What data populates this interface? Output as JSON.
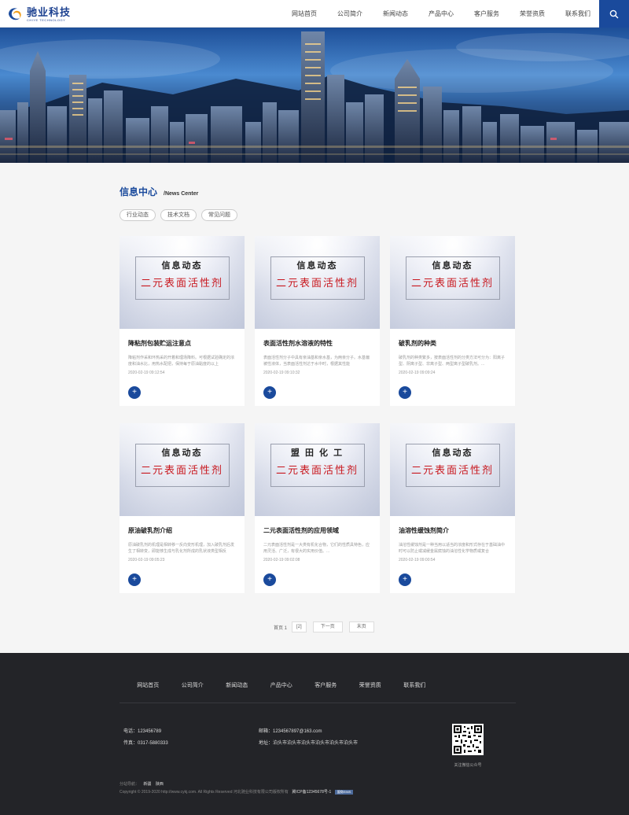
{
  "header": {
    "logo_cn": "驰业科技",
    "logo_en": "CHIYE TECHNOLOGY",
    "nav": [
      "网站首页",
      "公司简介",
      "新闻动态",
      "产品中心",
      "客户服务",
      "荣誉资质",
      "联系我们"
    ]
  },
  "section": {
    "title": "信息中心",
    "subtitle": "/News Center",
    "tabs": [
      "行业动态",
      "技术文档",
      "常见问题"
    ]
  },
  "cards": [
    {
      "img_top": "信息动态",
      "img_main": "二元表面活性剂",
      "title": "降粘剂包装贮运注意点",
      "desc": "降粘剂作采和环热采的开着和理场降料。可根据试验确定的浓度和油水比，用热水配把，保持每于原油黏度的以上",
      "date": "2020-02-19 09:12:54"
    },
    {
      "img_top": "信息动态",
      "img_main": "二元表面活性剂",
      "title": "表面活性剂水溶液的特性",
      "desc": "表面活性剂分子中具有亲油基和亲水基，为两亲分子。水基偏被性液体，当表面活性剂达于水中时，根据其性能",
      "date": "2020-02-19 09:10:32"
    },
    {
      "img_top": "信息动态",
      "img_main": "二元表面活性剂",
      "title": "破乳剂的种类",
      "desc": "破乳剂的种类繁多，按表面活性剂的分类方法可分为：阳离子型、阴离子型、非离子型、两型离子型破乳剂。...",
      "date": "2020-02-19 09:09:24"
    },
    {
      "img_top": "信息动态",
      "img_main": "二元表面活性剂",
      "title": "原油破乳剂介绍",
      "desc": "原油破乳剂的机理是相转移一反向变形机理，加入破乳剂后发生了相转变，即能够生成与乳化剂所成的乳状液类型相反",
      "date": "2020-02-19 09:05:23"
    },
    {
      "img_top": "盟 田 化 工",
      "img_main": "二元表面活性剂",
      "title": "二元表面活性剂的应用领域",
      "desc": "二元表面活性剂是一大类有机化合物，它们的性质具特色，应用灵活、广泛，有很大的实用价值。...",
      "date": "2020-02-19 09:02:08"
    },
    {
      "img_top": "信息动态",
      "img_main": "二元表面活性剂",
      "title": "油溶性缓蚀剂简介",
      "desc": "油溶性缓蚀剂是一种当用以适当的浓度和形式存在于基础油中时可以防止或减缓金属腐蚀的油溶性化学物质或复合",
      "date": "2020-02-19 09:00:54"
    }
  ],
  "pager": {
    "text": "首页 1",
    "current": "[2]",
    "next": "下一页",
    "last": "末页"
  },
  "footer": {
    "nav": [
      "网站首页",
      "公司简介",
      "新闻动态",
      "产品中心",
      "客户服务",
      "荣誉资质",
      "联系我们"
    ],
    "phone": "电话：123456789",
    "fax": "传真：0317-5880333",
    "email": "邮箱：1234567897@163.com",
    "address": "地址：泊头市泊头市泊头市泊头市泊头市泊头市",
    "qr_label": "关注微信公众号",
    "links_label": "分站导航：",
    "links": [
      "新疆",
      "陕西"
    ],
    "copyright": "Copyright © 2019-2020 http://www.cykj.com. All Rights Reserved 河北驰业科技有限公司版权所有",
    "icp": "冀ICP备12345678号-1",
    "badge": "盟商EIMS"
  }
}
